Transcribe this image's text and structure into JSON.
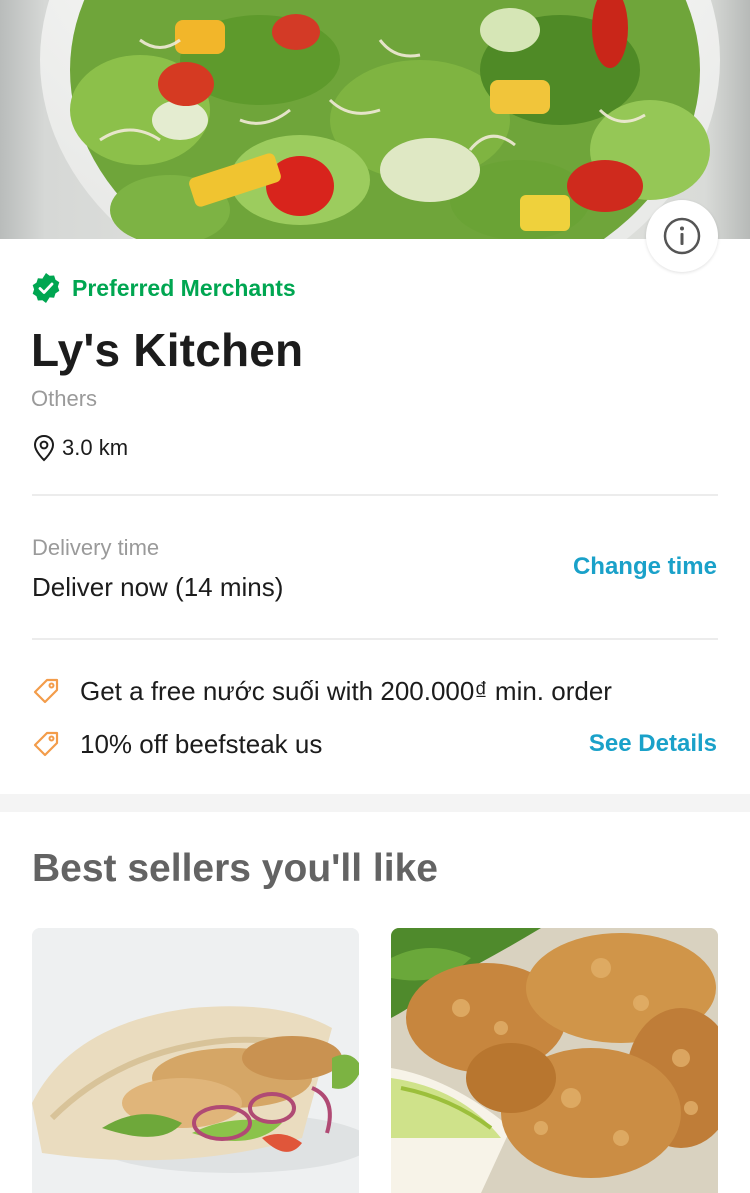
{
  "hero": {
    "image": "salad-photo"
  },
  "merchant": {
    "badge_icon": "verified-check-icon",
    "badge_label": "Preferred Merchants",
    "name": "Ly's Kitchen",
    "category": "Others",
    "distance": "3.0 km"
  },
  "delivery": {
    "label": "Delivery time",
    "value": "Deliver now (14 mins)",
    "change_label": "Change time"
  },
  "promos": [
    {
      "icon": "tag-icon",
      "text": "Get a free nước suối  with 200.000₫ min. order"
    },
    {
      "icon": "tag-icon",
      "text": "10% off beefsteak us"
    }
  ],
  "see_details_label": "See Details",
  "best_sellers": {
    "title": "Best sellers you'll like",
    "items": [
      {
        "image": "pita-wrap-photo"
      },
      {
        "image": "fried-chicken-photo"
      }
    ]
  },
  "colors": {
    "accent_green": "#00a651",
    "link_blue": "#1aa1c9",
    "promo_orange": "#f39c4a"
  }
}
